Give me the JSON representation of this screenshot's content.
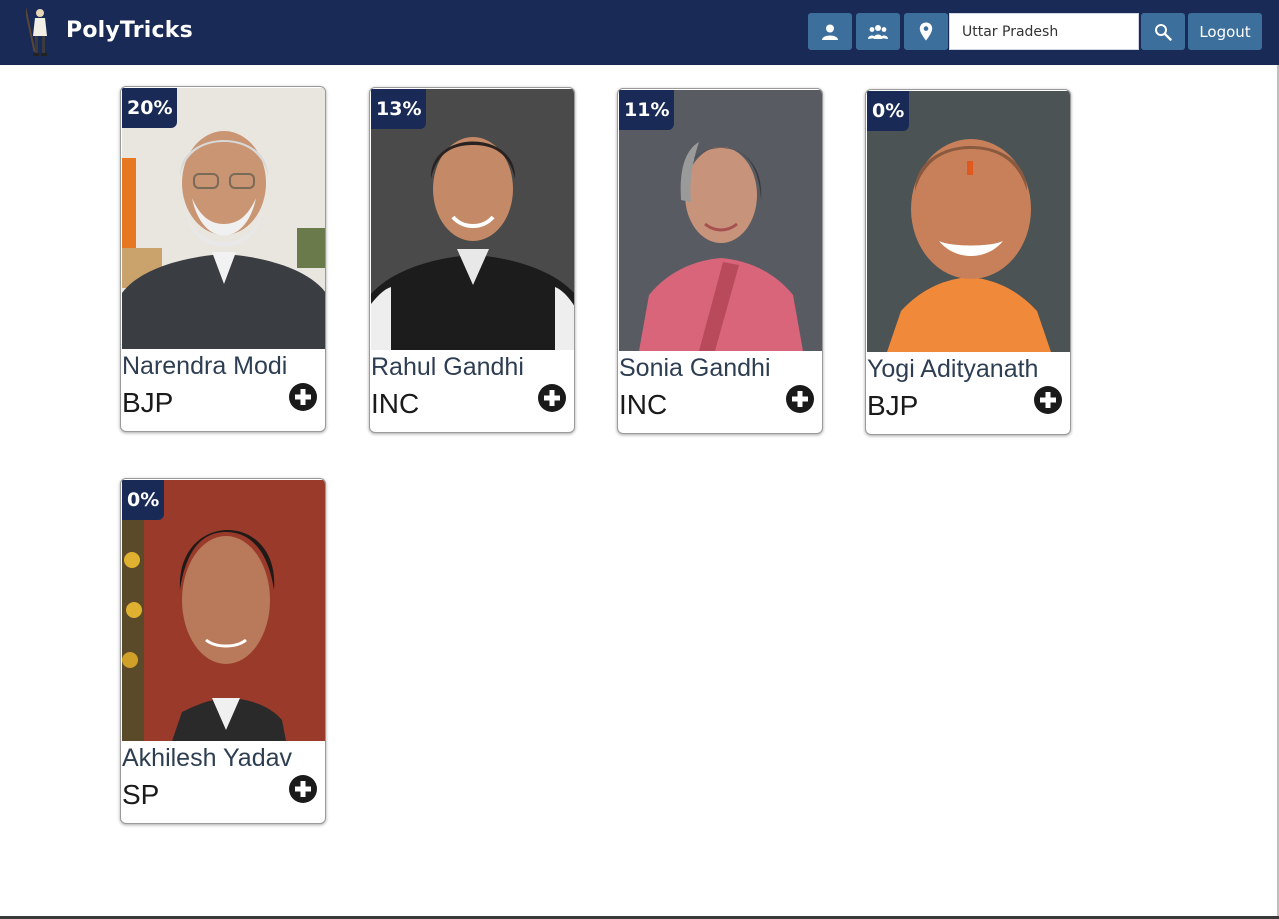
{
  "header": {
    "brand": "PolyTricks",
    "icons": {
      "logo": "leader-figure-icon",
      "profile": "user-icon",
      "group": "group-icon",
      "location": "location-pin-icon",
      "search": "search-icon"
    },
    "search": {
      "value": "Uttar Pradesh"
    },
    "logout_label": "Logout"
  },
  "colors": {
    "navbar": "#1a2a56",
    "button": "#3d6f9c",
    "badge": "#1a2a56"
  },
  "leaders": [
    {
      "percent": "20%",
      "name": "Narendra Modi",
      "party": "BJP"
    },
    {
      "percent": "13%",
      "name": "Rahul Gandhi",
      "party": "INC"
    },
    {
      "percent": "11%",
      "name": "Sonia Gandhi",
      "party": "INC"
    },
    {
      "percent": "0%",
      "name": "Yogi Adityanath",
      "party": "BJP"
    },
    {
      "percent": "0%",
      "name": "Akhilesh Yadav",
      "party": "SP"
    }
  ],
  "card_icon": "plus-circle-icon"
}
